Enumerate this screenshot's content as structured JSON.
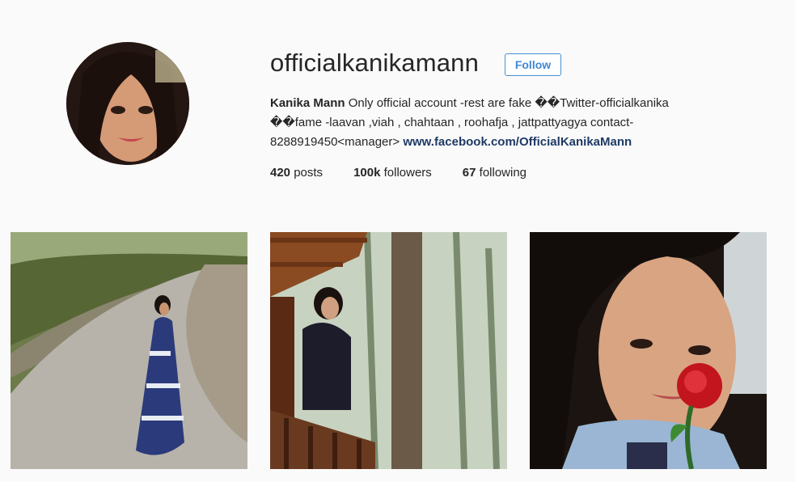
{
  "profile": {
    "username": "officialkanikamann",
    "follow_label": "Follow",
    "full_name": "Kanika Mann",
    "bio_text": "Only official account -rest are fake ��Twitter-officialkanika ��fame -laavan ,viah , chahtaan , roohafja , jattpattyagya contact- 8288919450<manager>",
    "website": "www.facebook.com/OfficialKanikaMann"
  },
  "stats": {
    "posts_count": "420",
    "posts_label": "posts",
    "followers_count": "100k",
    "followers_label": "followers",
    "following_count": "67",
    "following_label": "following"
  },
  "posts": [
    {
      "kind": "photo-on-mountain-road"
    },
    {
      "kind": "photo-on-wooden-balcony"
    },
    {
      "kind": "selfie-with-rose"
    }
  ],
  "colors": {
    "background": "#fafafa",
    "follow_blue": "#3f88d4",
    "link_navy": "#1f3a66"
  }
}
